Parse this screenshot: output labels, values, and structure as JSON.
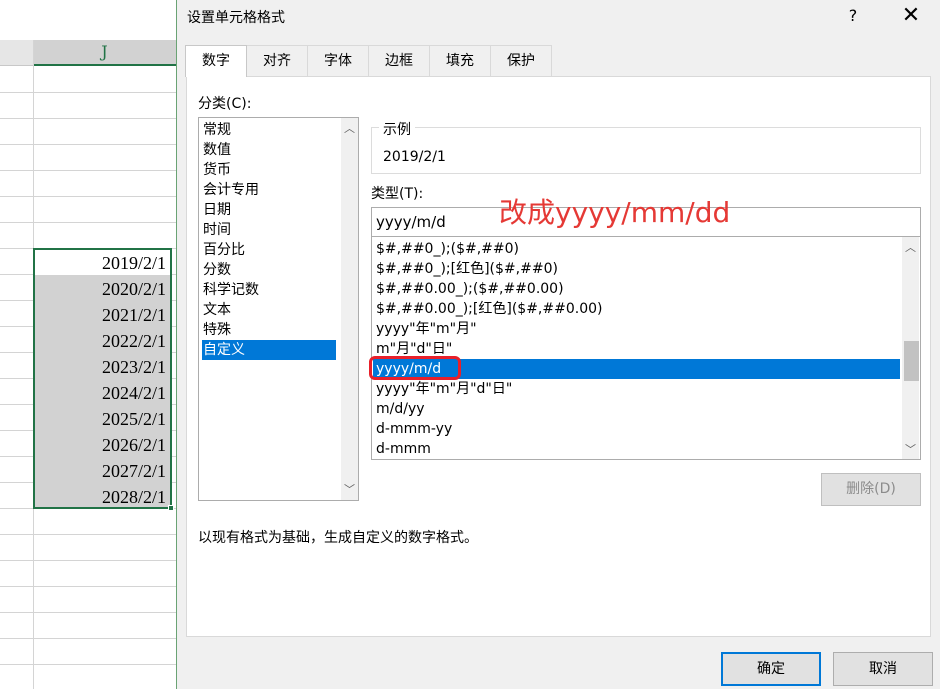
{
  "sheet": {
    "column_header": "J",
    "cells": [
      "2019/2/1",
      "2020/2/1",
      "2021/2/1",
      "2022/2/1",
      "2023/2/1",
      "2024/2/1",
      "2025/2/1",
      "2026/2/1",
      "2027/2/1",
      "2028/2/1"
    ]
  },
  "dialog": {
    "title": "设置单元格格式",
    "help": "?",
    "close": "✕",
    "tabs": [
      "数字",
      "对齐",
      "字体",
      "边框",
      "填充",
      "保护"
    ],
    "active_tab": "数字",
    "category_label": "分类(C):",
    "categories": [
      "常规",
      "数值",
      "货币",
      "会计专用",
      "日期",
      "时间",
      "百分比",
      "分数",
      "科学记数",
      "文本",
      "特殊",
      "自定义"
    ],
    "selected_category": "自定义",
    "sample_label": "示例",
    "sample_value": "2019/2/1",
    "type_label": "类型(T):",
    "type_value": "yyyy/m/d",
    "annotation": "改成yyyy/mm/dd",
    "formats": [
      "$#,##0_);($#,##0)",
      "$#,##0_);[红色]($#,##0)",
      "$#,##0.00_);($#,##0.00)",
      "$#,##0.00_);[红色]($#,##0.00)",
      "yyyy\"年\"m\"月\"",
      "m\"月\"d\"日\"",
      "yyyy/m/d",
      "yyyy\"年\"m\"月\"d\"日\"",
      "m/d/yy",
      "d-mmm-yy",
      "d-mmm"
    ],
    "selected_format": "yyyy/m/d",
    "delete_button": "删除(D)",
    "description": "以现有格式为基础，生成自定义的数字格式。",
    "ok_button": "确定",
    "cancel_button": "取消"
  },
  "colors": {
    "selection_blue": "#0078d7",
    "excel_green": "#217346",
    "annotation_red": "#e53935"
  }
}
